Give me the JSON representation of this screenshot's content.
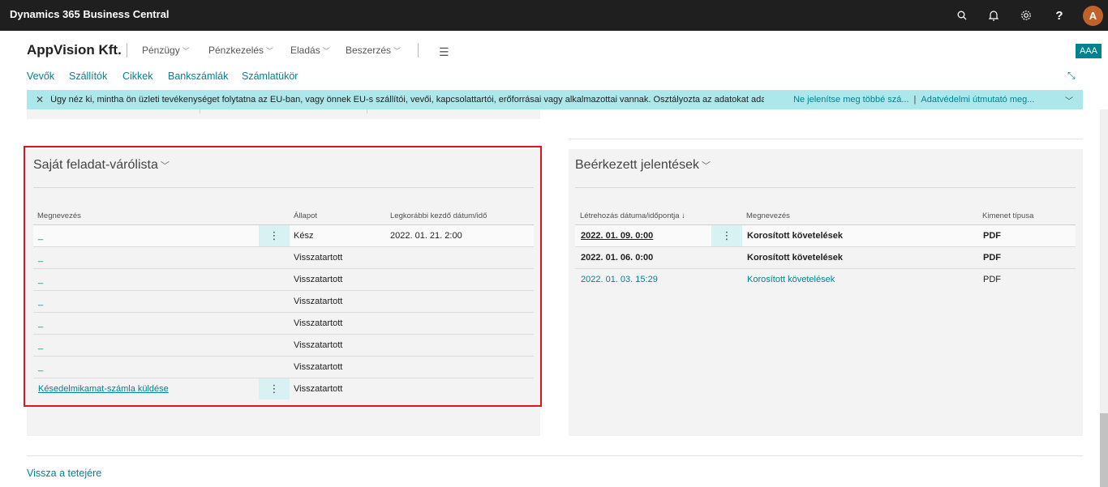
{
  "app": {
    "title": "Dynamics 365 Business Central",
    "avatar_initial": "A",
    "icons": [
      "search-icon",
      "bell-icon",
      "settings-gear-icon",
      "help-icon"
    ]
  },
  "header": {
    "company": "AppVision Kft.",
    "menus": [
      {
        "label": "Pénzügy"
      },
      {
        "label": "Pénzkezelés"
      },
      {
        "label": "Eladás"
      },
      {
        "label": "Beszerzés"
      }
    ],
    "badge": "AAA"
  },
  "actions": [
    "Vevők",
    "Szállítók",
    "Cikkek",
    "Bankszámlák",
    "Számlatükör"
  ],
  "banner": {
    "message": "Úgy néz ki, mintha ön üzleti tevékenységet folytatna az EU-ban, vagy önnek EU-s szállítói, vevői, kapcsolattartói, erőforrásai vagy alkalmazottai vannak. Osztályozta az adatokat adat...",
    "dismiss_link": "Ne jelenítse meg többé szá...",
    "separator": "|",
    "privacy_link": "Adatvédelmi útmutató meg..."
  },
  "queue_panel": {
    "title": "Saját feladat-várólista",
    "columns": [
      "Megnevezés",
      "Állapot",
      "Legkorábbi kezdő dátum/idő"
    ],
    "rows": [
      {
        "name": "_",
        "status": "Kész",
        "date": "2022. 01. 21. 2:00"
      },
      {
        "name": "_",
        "status": "Visszatartott",
        "date": ""
      },
      {
        "name": "_",
        "status": "Visszatartott",
        "date": ""
      },
      {
        "name": "_",
        "status": "Visszatartott",
        "date": ""
      },
      {
        "name": "_",
        "status": "Visszatartott",
        "date": ""
      },
      {
        "name": "_",
        "status": "Visszatartott",
        "date": ""
      },
      {
        "name": "_",
        "status": "Visszatartott",
        "date": ""
      },
      {
        "name": "Késedelmikamat-számla küldése",
        "status": "Visszatartott",
        "date": ""
      }
    ]
  },
  "reports_panel": {
    "title": "Beérkezett jelentések",
    "columns": [
      "Létrehozás dátuma/időpontja ↓",
      "Megnevezés",
      "Kimenet típusa"
    ],
    "rows": [
      {
        "date": "2022. 01. 09. 0:00",
        "name": "Korosított követelések",
        "type": "PDF"
      },
      {
        "date": "2022. 01. 06. 0:00",
        "name": "Korosított követelések",
        "type": "PDF"
      },
      {
        "date": "2022. 01. 03. 15:29",
        "name": "Korosított követelések",
        "type": "PDF"
      }
    ]
  },
  "footer": {
    "back_to_top": "Vissza a tetejére"
  }
}
